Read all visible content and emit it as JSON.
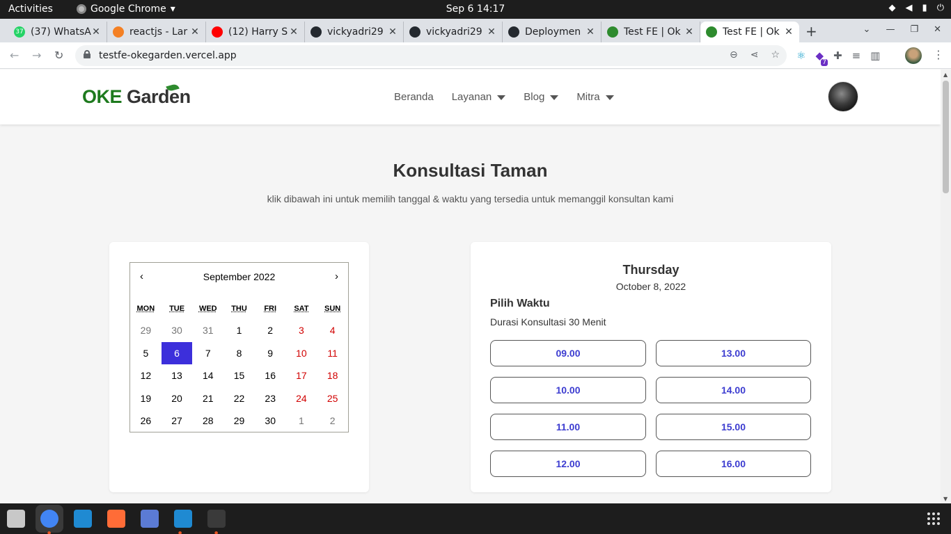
{
  "system": {
    "activities": "Activities",
    "app_name": "Google Chrome",
    "app_caret": "▾",
    "clock": "Sep 6  14:17"
  },
  "tabs": [
    {
      "title": "(37) WhatsA",
      "icon": "whatsapp-icon",
      "color": "#25d366",
      "fav_text": "37"
    },
    {
      "title": "reactjs - Lar",
      "icon": "stackoverflow-icon",
      "color": "#f48024",
      "fav_text": ""
    },
    {
      "title": "(12) Harry S",
      "icon": "youtube-icon",
      "color": "#ff0000",
      "fav_text": ""
    },
    {
      "title": "vickyadri29",
      "icon": "github-icon",
      "color": "#24292f",
      "fav_text": ""
    },
    {
      "title": "vickyadri29",
      "icon": "github-icon",
      "color": "#24292f",
      "fav_text": ""
    },
    {
      "title": "Deploymen",
      "icon": "github-icon",
      "color": "#24292f",
      "fav_text": ""
    },
    {
      "title": "Test FE | Ok",
      "icon": "okegarden-leaf-icon",
      "color": "#2e8b2e",
      "fav_text": ""
    },
    {
      "title": "Test FE | Ok",
      "icon": "okegarden-leaf-icon",
      "color": "#2e8b2e",
      "fav_text": "",
      "active": true
    }
  ],
  "browser": {
    "url": "testfe-okegarden.vercel.app",
    "extension_badge": "7"
  },
  "site": {
    "logo_oke": "OKE",
    "logo_garden": "Garden",
    "nav": [
      {
        "label": "Beranda",
        "dropdown": false
      },
      {
        "label": "Layanan",
        "dropdown": true
      },
      {
        "label": "Blog",
        "dropdown": true
      },
      {
        "label": "Mitra",
        "dropdown": true
      }
    ]
  },
  "main": {
    "title": "Konsultasi Taman",
    "subtitle": "klik dibawah ini untuk memilih tanggal & waktu yang tersedia untuk memanggil konsultan kami"
  },
  "calendar": {
    "prev": "‹",
    "next": "›",
    "month_label": "September 2022",
    "weekdays": [
      "MON",
      "TUE",
      "WED",
      "THU",
      "FRI",
      "SAT",
      "SUN"
    ],
    "days": [
      {
        "d": "29",
        "neighbor": true
      },
      {
        "d": "30",
        "neighbor": true
      },
      {
        "d": "31",
        "neighbor": true
      },
      {
        "d": "1"
      },
      {
        "d": "2"
      },
      {
        "d": "3",
        "weekend": true
      },
      {
        "d": "4",
        "weekend": true
      },
      {
        "d": "5"
      },
      {
        "d": "6",
        "selected": true
      },
      {
        "d": "7"
      },
      {
        "d": "8"
      },
      {
        "d": "9"
      },
      {
        "d": "10",
        "weekend": true
      },
      {
        "d": "11",
        "weekend": true
      },
      {
        "d": "12"
      },
      {
        "d": "13"
      },
      {
        "d": "14"
      },
      {
        "d": "15"
      },
      {
        "d": "16"
      },
      {
        "d": "17",
        "weekend": true
      },
      {
        "d": "18",
        "weekend": true
      },
      {
        "d": "19"
      },
      {
        "d": "20"
      },
      {
        "d": "21"
      },
      {
        "d": "22"
      },
      {
        "d": "23"
      },
      {
        "d": "24",
        "weekend": true
      },
      {
        "d": "25",
        "weekend": true
      },
      {
        "d": "26"
      },
      {
        "d": "27"
      },
      {
        "d": "28"
      },
      {
        "d": "29"
      },
      {
        "d": "30"
      },
      {
        "d": "1",
        "neighbor": true
      },
      {
        "d": "2",
        "neighbor": true
      }
    ]
  },
  "time_panel": {
    "day_name": "Thursday",
    "date": "October 8, 2022",
    "pick_label": "Pilih Waktu",
    "duration": "Durasi Konsultasi 30 Menit",
    "slots": [
      "09.00",
      "13.00",
      "10.00",
      "14.00",
      "11.00",
      "15.00",
      "12.00",
      "16.00"
    ]
  },
  "colors": {
    "brand_green": "#1e7a1e",
    "selected_day": "#3c2fdb",
    "weekend_red": "#d10000",
    "slot_text": "#3c3cd0"
  },
  "dock": [
    {
      "name": "files-icon",
      "color": "#c8c8c8"
    },
    {
      "name": "chrome-icon",
      "color": "#4285f4"
    },
    {
      "name": "vscode-icon",
      "color": "#1f8ad2"
    },
    {
      "name": "postman-icon",
      "color": "#ff6c37"
    },
    {
      "name": "screenshot-icon",
      "color": "#5b7bd5"
    },
    {
      "name": "vscode-icon",
      "color": "#1f8ad2"
    },
    {
      "name": "terminal-icon",
      "color": "#3a3a3a"
    }
  ]
}
